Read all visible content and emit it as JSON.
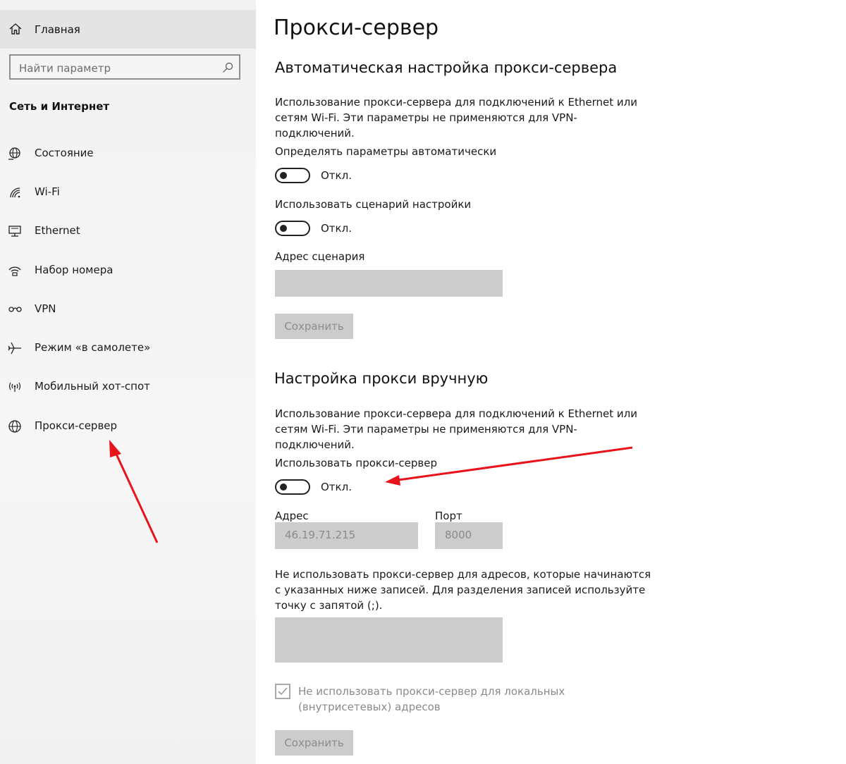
{
  "sidebar": {
    "home_label": "Главная",
    "search_placeholder": "Найти параметр",
    "section_title": "Сеть и Интернет",
    "items": [
      {
        "label": "Состояние",
        "icon": "globe-status-icon"
      },
      {
        "label": "Wi-Fi",
        "icon": "wifi-icon"
      },
      {
        "label": "Ethernet",
        "icon": "ethernet-icon"
      },
      {
        "label": "Набор номера",
        "icon": "dialup-icon"
      },
      {
        "label": "VPN",
        "icon": "vpn-icon"
      },
      {
        "label": "Режим «в самолете»",
        "icon": "airplane-icon"
      },
      {
        "label": "Мобильный хот-спот",
        "icon": "hotspot-icon"
      },
      {
        "label": "Прокси-сервер",
        "icon": "globe-icon"
      }
    ]
  },
  "main": {
    "title": "Прокси-сервер",
    "auto": {
      "heading": "Автоматическая настройка прокси-сервера",
      "description": "Использование прокси-сервера для подключений к Ethernet или сетям Wi-Fi. Эти параметры не применяются для VPN-подключений.",
      "detect_label": "Определять параметры автоматически",
      "detect_state": "Откл.",
      "script_label": "Использовать сценарий настройки",
      "script_state": "Откл.",
      "address_label": "Адрес сценария",
      "address_value": "",
      "save_label": "Сохранить"
    },
    "manual": {
      "heading": "Настройка прокси вручную",
      "description": "Использование прокси-сервера для подключений к Ethernet или сетям Wi-Fi. Эти параметры не применяются для VPN-подключений.",
      "use_proxy_label": "Использовать прокси-сервер",
      "use_proxy_state": "Откл.",
      "address_label": "Адрес",
      "address_value": "46.19.71.215",
      "port_label": "Порт",
      "port_value": "8000",
      "exceptions_description": "Не использовать прокси-сервер для адресов, которые начинаются с указанных ниже записей. Для разделения записей используйте точку с запятой (;).",
      "exceptions_value": "",
      "local_checkbox_label": "Не использовать прокси-сервер для локальных (внутрисетевых) адресов",
      "local_checkbox_checked": true,
      "save_label": "Сохранить"
    }
  },
  "colors": {
    "annotation_arrow": "#e8141b",
    "sidebar_bg": "#f3f3f3",
    "home_highlight": "#e4e4e4",
    "disabled_field": "#cccccc"
  }
}
